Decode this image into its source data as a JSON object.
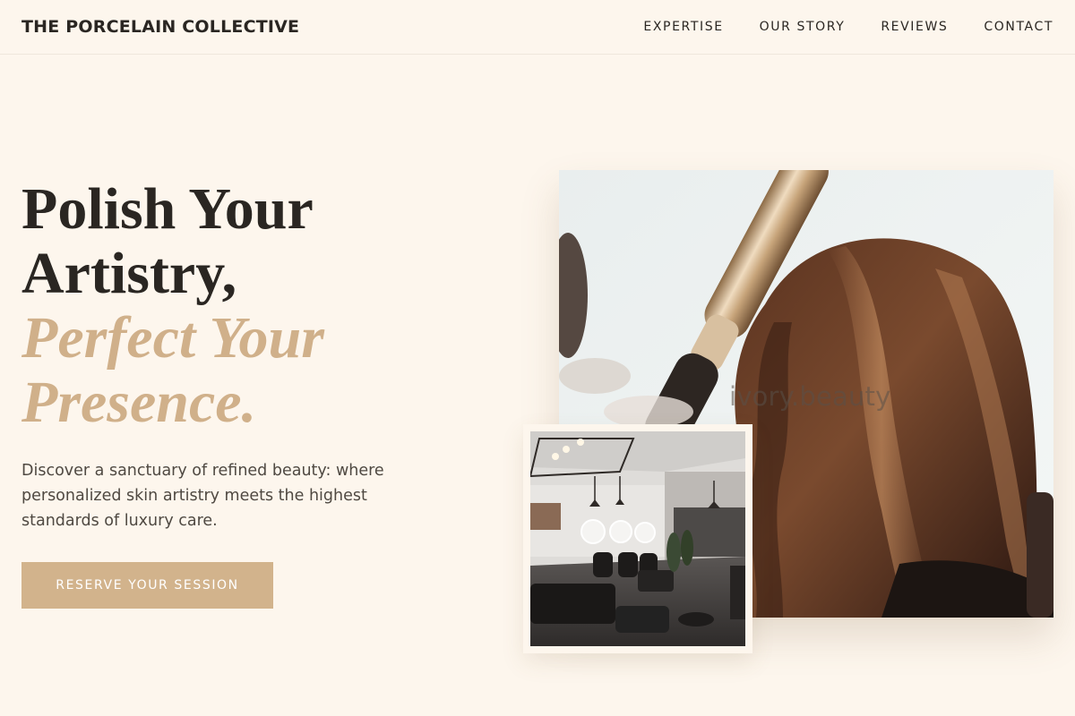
{
  "nav": {
    "brand": "THE PORCELAIN COLLECTIVE",
    "links": [
      {
        "label": "EXPERTISE"
      },
      {
        "label": "OUR STORY"
      },
      {
        "label": "REVIEWS"
      },
      {
        "label": "CONTACT"
      }
    ]
  },
  "hero": {
    "title_line1": "Polish Your",
    "title_line2": "Artistry,",
    "title_accent_line1": "Perfect Your",
    "title_accent_line2": "Presence.",
    "description": "Discover a sanctuary of refined beauty: where personalized skin artistry meets the highest standards of luxury care.",
    "cta_label": "RESERVE YOUR SESSION"
  },
  "images": {
    "main_watermark": "ivory.beauty",
    "main_icon": "hair-curling-photo",
    "inset_icon": "salon-interior-photo"
  },
  "colors": {
    "background": "#fdf6ed",
    "accent": "#d0b08a",
    "button": "#d2b38c",
    "text": "#2a2622"
  }
}
